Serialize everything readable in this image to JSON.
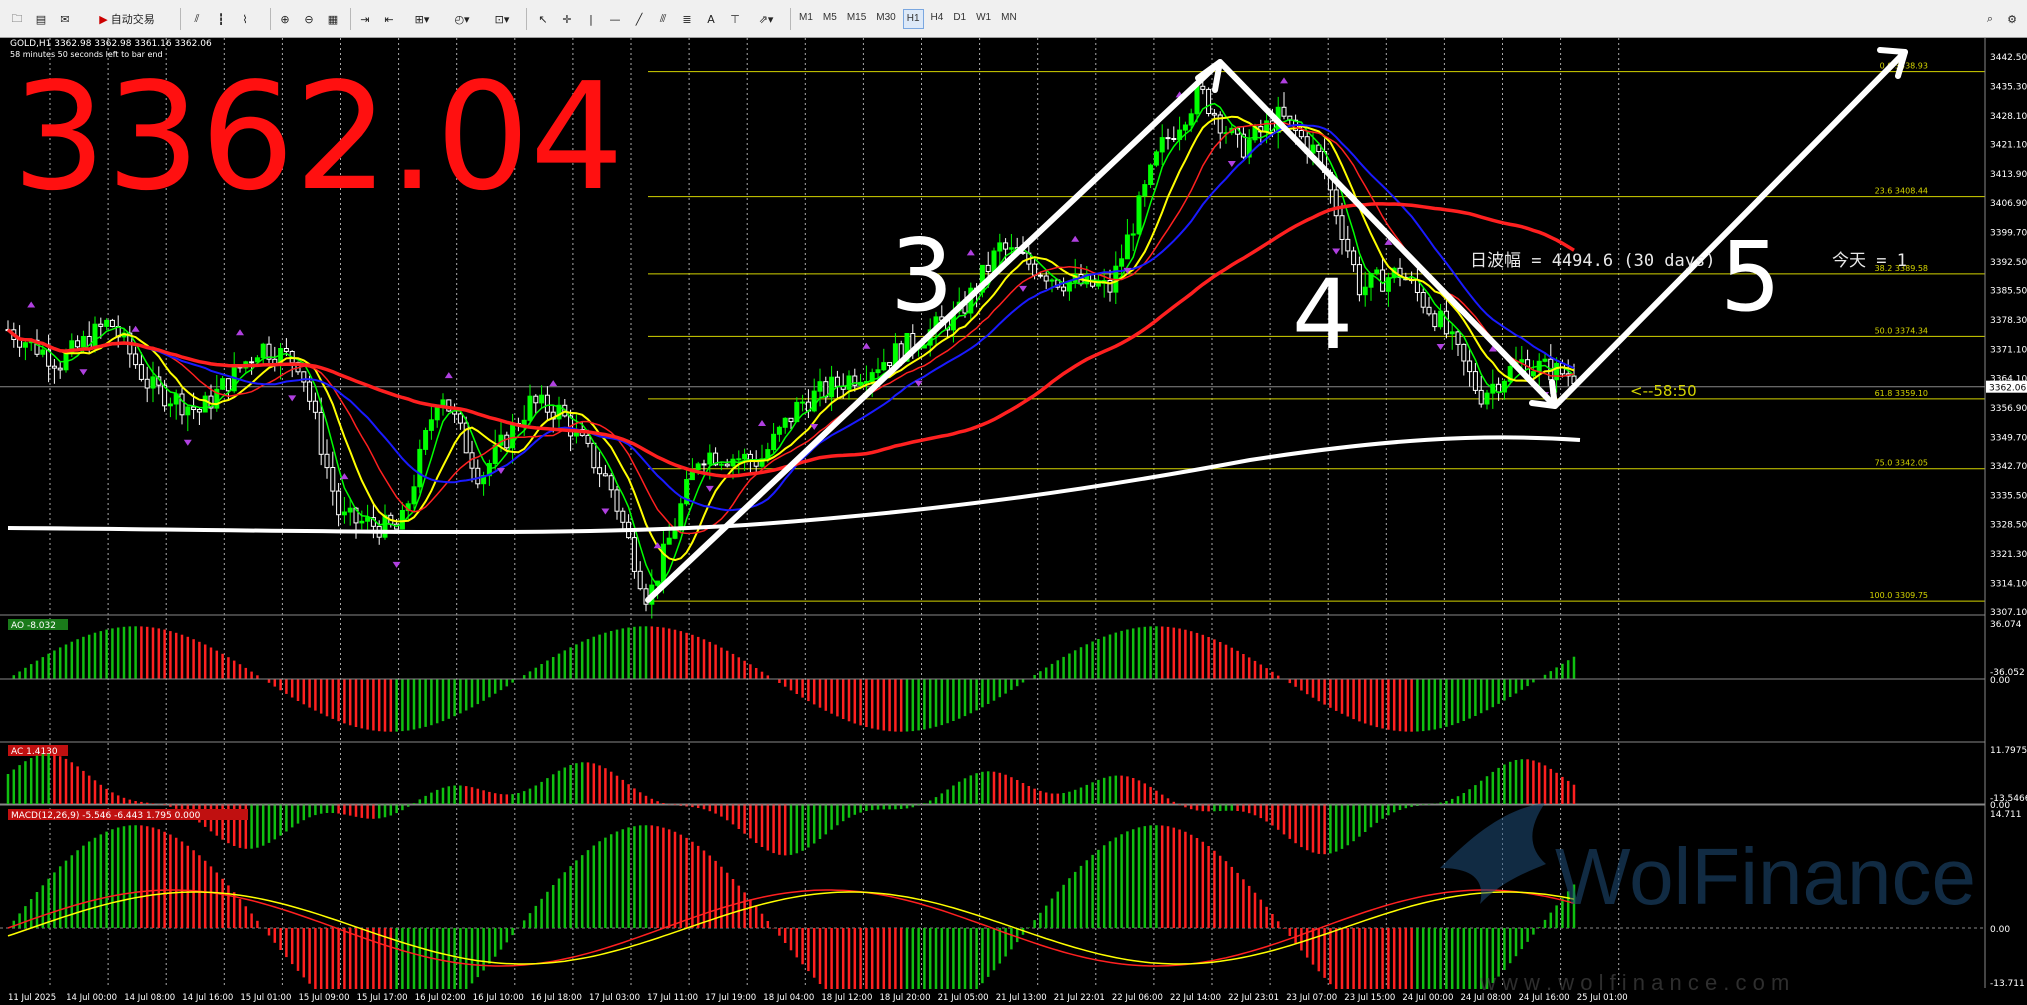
{
  "toolbar": {
    "auto_trade_label": "自动交易",
    "timeframes": [
      "M1",
      "M5",
      "M15",
      "M30",
      "H1",
      "H4",
      "D1",
      "W1",
      "MN"
    ],
    "active_timeframe": "H1"
  },
  "chart_info": {
    "symbol_line": "GOLD,H1  3362.98 3362.98 3361.16 3362.06",
    "timer_line": "58 minutes 50 seconds left to bar end"
  },
  "price_overlay": "3362.04",
  "price_axis": {
    "labels": [
      "3442.50",
      "3435.30",
      "3428.10",
      "3421.10",
      "3413.90",
      "3406.90",
      "3399.70",
      "3392.50",
      "3385.50",
      "3378.30",
      "3371.10",
      "3364.10",
      "3356.90",
      "3349.70",
      "3342.70",
      "3335.50",
      "3328.50",
      "3321.30",
      "3314.10",
      "3307.10"
    ],
    "current_price": "3362.06"
  },
  "fibonacci": [
    {
      "ratio": "0.0",
      "price": "3438.93"
    },
    {
      "ratio": "23.6",
      "price": "3408.44"
    },
    {
      "ratio": "38.2",
      "price": "3389.58"
    },
    {
      "ratio": "50.0",
      "price": "3374.34"
    },
    {
      "ratio": "61.8",
      "price": "3359.10"
    },
    {
      "ratio": "75.0",
      "price": "3342.05"
    },
    {
      "ratio": "100.0",
      "price": "3309.75"
    }
  ],
  "annotations": {
    "range_text": "日波幅 = 4494.6  (30 days)",
    "today_text": "今天 = 1",
    "countdown": "<--58:50",
    "wave3": "3",
    "wave4": "4",
    "wave5": "5"
  },
  "indicators": {
    "ao": {
      "label": "AO -8.032",
      "top": "36.074",
      "zero": "0.00",
      "bottom": "-36.052"
    },
    "ac": {
      "label": "AC 1.4130",
      "top": "11.7975",
      "zero": "0.00",
      "bottom": "-13.5466"
    },
    "macd": {
      "label": "MACD(12,26,9) -5.546 -6.443 1.795 0.000",
      "top": "14.711",
      "zero": "0.00",
      "bottom": "-13.711"
    }
  },
  "time_axis": [
    "11 Jul 2025",
    "14 Jul 00:00",
    "14 Jul 08:00",
    "14 Jul 16:00",
    "15 Jul 01:00",
    "15 Jul 09:00",
    "15 Jul 17:00",
    "16 Jul 02:00",
    "16 Jul 10:00",
    "16 Jul 18:00",
    "17 Jul 03:00",
    "17 Jul 11:00",
    "17 Jul 19:00",
    "18 Jul 04:00",
    "18 Jul 12:00",
    "18 Jul 20:00",
    "21 Jul 05:00",
    "21 Jul 13:00",
    "21 Jul 22:01",
    "22 Jul 06:00",
    "22 Jul 14:00",
    "22 Jul 23:01",
    "23 Jul 07:00",
    "23 Jul 15:00",
    "24 Jul 00:00",
    "24 Jul 08:00",
    "24 Jul 16:00",
    "25 Jul 01:00"
  ],
  "watermark": {
    "brand": "WolFinance",
    "url": "w w w . w o l f i n a n c e . c o m"
  },
  "colors": {
    "background": "#000000",
    "bull_candle": "#00ff00",
    "bear_candle": "#ffffff",
    "fib": "#d4d400",
    "ma_fast": "#00ff00",
    "ma_mid": "#ffff00",
    "ma_red": "#ff2020",
    "ma_blue": "#1a1aff",
    "ma_long": "#ffffff",
    "macd_signal": "#ffff00"
  }
}
